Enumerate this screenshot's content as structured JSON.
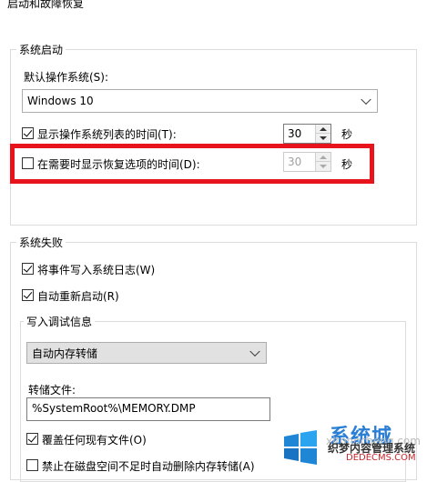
{
  "dialog": {
    "title": "启动和故障恢复"
  },
  "system_startup": {
    "group_title": "系统启动",
    "default_os_label": "默认操作系统(S):",
    "default_os_value": "Windows 10",
    "show_os_list": {
      "label": "显示操作系统列表的时间(T):",
      "checked": true,
      "value": "30",
      "unit": "秒"
    },
    "show_recovery": {
      "label": "在需要时显示恢复选项的时间(D):",
      "checked": false,
      "value": "30",
      "unit": "秒"
    }
  },
  "system_failure": {
    "group_title": "系统失败",
    "write_event_log": {
      "label": "将事件写入系统日志(W)",
      "checked": true
    },
    "auto_restart": {
      "label": "自动重新启动(R)",
      "checked": true
    },
    "debug_info": {
      "group_title": "写入调试信息",
      "dump_type": "自动内存转储",
      "dump_file_label": "转储文件:",
      "dump_file_value": "%SystemRoot%\\MEMORY.DMP",
      "overwrite": {
        "label": "覆盖任何现有文件(O)",
        "checked": true
      },
      "disable_auto_delete": {
        "label": "禁止在磁盘空间不足时自动删除内存转储(A)",
        "checked": false
      }
    }
  },
  "watermark": {
    "brand": "系统城",
    "domain": "xitongcheng.com",
    "site_name": "织梦内容管理系统",
    "site_url": "DEDECMS.COM"
  },
  "colors": {
    "highlight": "#e8141b",
    "watermark_blue": "#2a7fd4"
  }
}
